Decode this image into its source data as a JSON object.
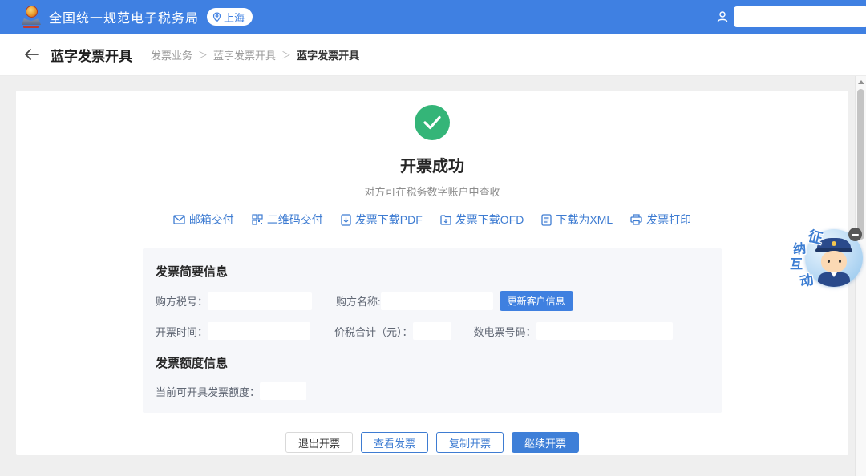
{
  "colors": {
    "header_blue": "#3f80e2",
    "accent_blue": "#3e7cd2",
    "primary_button_blue": "#3e7fd8",
    "success_green": "#34b578"
  },
  "header": {
    "title": "全国统一规范电子税务局",
    "location": "上海"
  },
  "breadcrumb": {
    "page_title": "蓝字发票开具",
    "separator": "＞",
    "items": [
      "发票业务",
      "蓝字发票开具",
      "蓝字发票开具"
    ]
  },
  "result": {
    "title": "开票成功",
    "subtitle": "对方可在税务数字账户中查收"
  },
  "actions": [
    {
      "icon": "mail-icon",
      "label": "邮箱交付"
    },
    {
      "icon": "qrcode-icon",
      "label": "二维码交付"
    },
    {
      "icon": "file-pdf-icon",
      "label": "发票下载PDF"
    },
    {
      "icon": "file-ofd-icon",
      "label": "发票下载OFD"
    },
    {
      "icon": "file-xml-icon",
      "label": "下载为XML"
    },
    {
      "icon": "printer-icon",
      "label": "发票打印"
    }
  ],
  "invoice_summary": {
    "title": "发票简要信息",
    "buyer_tax_no_label": "购方税号：",
    "buyer_tax_no_value": "",
    "buyer_name_label": "购方名称:",
    "buyer_name_value": "",
    "update_customer_button": "更新客户信息",
    "issue_time_label": "开票时间：",
    "issue_time_value": "",
    "total_with_tax_label": "价税合计（元）：",
    "total_with_tax_value": "",
    "digital_invoice_no_label": "数电票号码：",
    "digital_invoice_no_value": ""
  },
  "quota_info": {
    "title": "发票额度信息",
    "current_quota_label": "当前可开具发票额度：",
    "current_quota_value": ""
  },
  "footer": {
    "buttons": [
      {
        "label": "退出开票",
        "style": "default"
      },
      {
        "label": "查看发票",
        "style": "outline"
      },
      {
        "label": "复制开票",
        "style": "outline"
      },
      {
        "label": "继续开票",
        "style": "primary"
      }
    ]
  },
  "assistant_widget": {
    "name": "征纳互动",
    "chars": [
      "征",
      "纳",
      "互",
      "动"
    ]
  }
}
